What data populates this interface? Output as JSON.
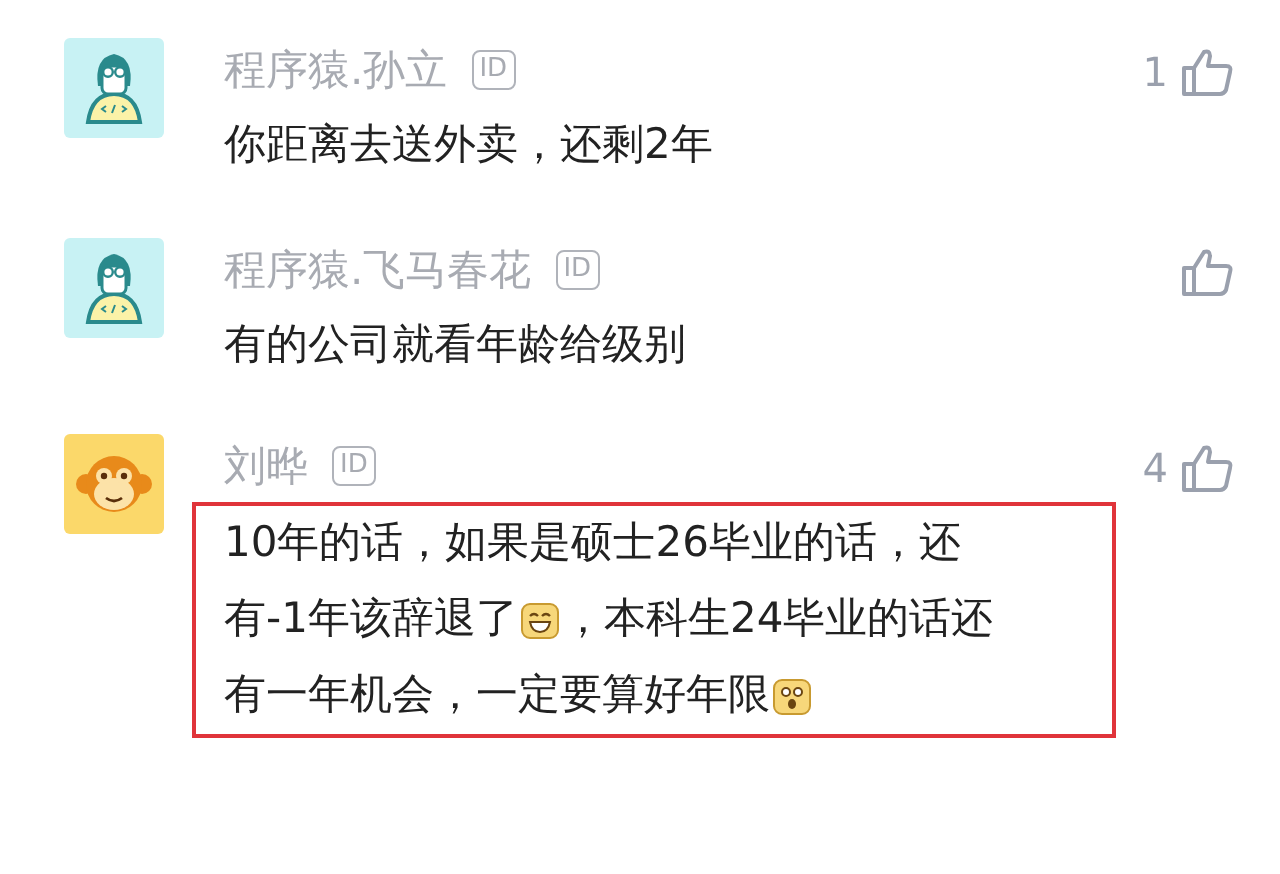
{
  "comments": [
    {
      "avatar": {
        "kind": "coder"
      },
      "name": "程序猿.孙立",
      "badge": "ID",
      "likes": "1",
      "highlighted": false,
      "lines": [
        [
          {
            "kind": "text",
            "text": "你距离去送外卖，还剩2年"
          }
        ]
      ]
    },
    {
      "avatar": {
        "kind": "coder"
      },
      "name": "程序猿.飞马春花",
      "badge": "ID",
      "highlighted": false,
      "lines": [
        [
          {
            "kind": "text",
            "text": "有的公司就看年龄给级别"
          }
        ]
      ]
    },
    {
      "avatar": {
        "kind": "monkey"
      },
      "name": "刘晔",
      "badge": "ID",
      "likes": "4",
      "highlighted": true,
      "lines": [
        [
          {
            "kind": "text",
            "text": "10年的话，如果是硕士26毕业的话，还"
          }
        ],
        [
          {
            "kind": "text",
            "text": "有-1年该辞退了"
          },
          {
            "kind": "grin"
          },
          {
            "kind": "text",
            "text": "，本科生24毕业的话还"
          }
        ],
        [
          {
            "kind": "text",
            "text": "有一年机会，一定要算好年限"
          },
          {
            "kind": "surprised"
          }
        ]
      ]
    }
  ]
}
